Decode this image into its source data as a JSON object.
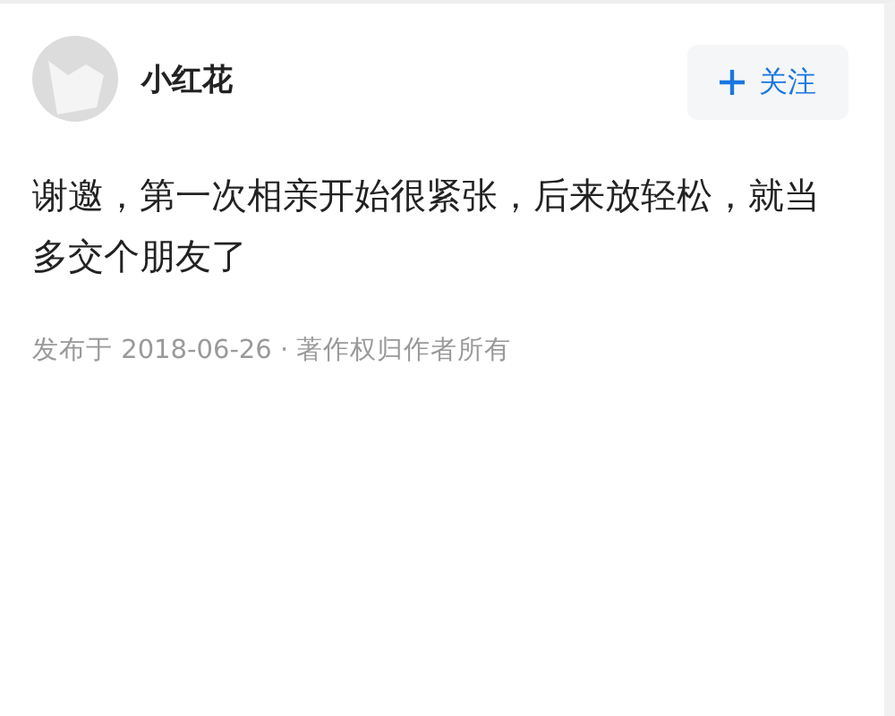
{
  "author": {
    "name": "小红花"
  },
  "follow_button": {
    "label": "关注"
  },
  "answer": {
    "text": "谢邀，第一次相亲开始很紧张，后来放轻松，就当多交个朋友了"
  },
  "meta": {
    "text": "发布于 2018-06-26 · 著作权归作者所有"
  }
}
